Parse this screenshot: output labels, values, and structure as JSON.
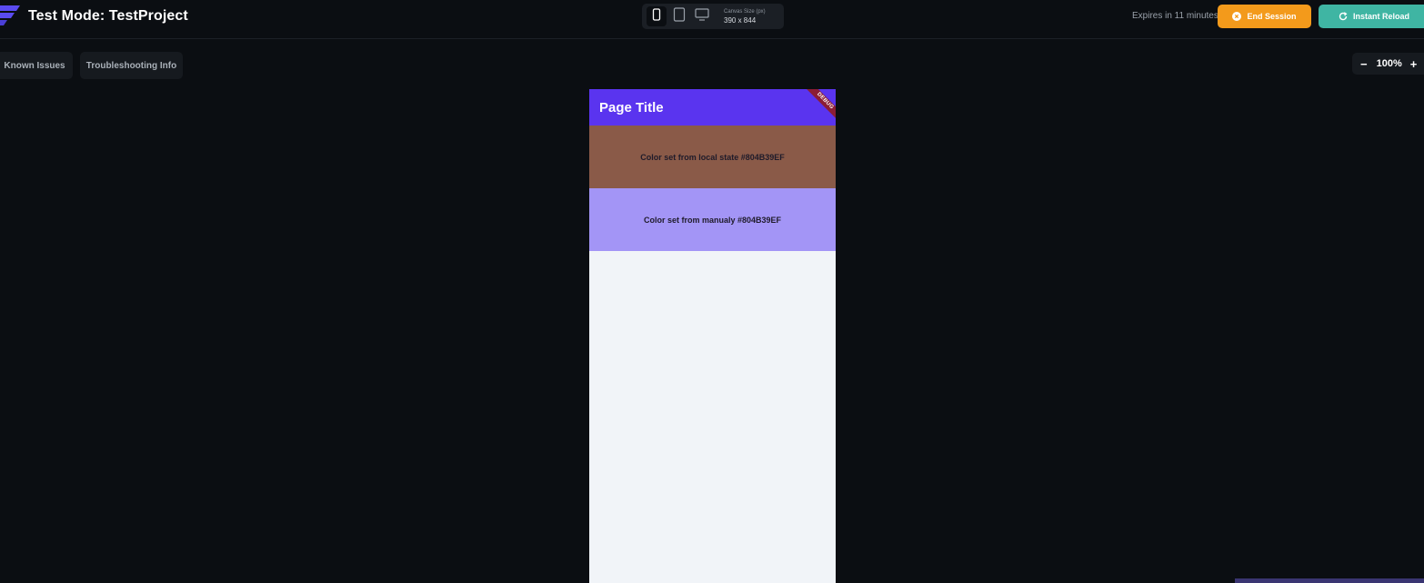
{
  "header": {
    "title": "Test Mode: TestProject",
    "logo_icon": "flutterflow-logo-icon",
    "device_switcher": {
      "devices": [
        {
          "name": "phone",
          "icon": "phone-icon",
          "active": true
        },
        {
          "name": "tablet",
          "icon": "tablet-icon",
          "active": false
        },
        {
          "name": "desktop",
          "icon": "desktop-icon",
          "active": false
        }
      ],
      "canvas_size_label": "Canvas Size (px)",
      "canvas_size_value": "390 x 844"
    },
    "expires_text": "Expires in 11 minutes",
    "end_session_label": "End Session",
    "instant_reload_label": "Instant Reload"
  },
  "toolbar": {
    "known_issues_label": "Known Issues",
    "troubleshooting_label": "Troubleshooting Info",
    "zoom_value": "100%",
    "zoom_minus": "−",
    "zoom_plus": "+"
  },
  "app_preview": {
    "page_title": "Page Title",
    "debug_banner": "DEBUG",
    "panels": [
      {
        "text": "Color set from local state #804B39EF"
      },
      {
        "text": "Color set from manualy #804B39EF"
      }
    ]
  },
  "colors": {
    "background": "#0b0e12",
    "app_bar": "#5a34ef",
    "panel_local": "#8a5a48",
    "panel_manual": "#a395f6",
    "page_background": "#f1f4f8",
    "end_session": "#f39a1b",
    "instant_reload": "#3fb5a3"
  }
}
